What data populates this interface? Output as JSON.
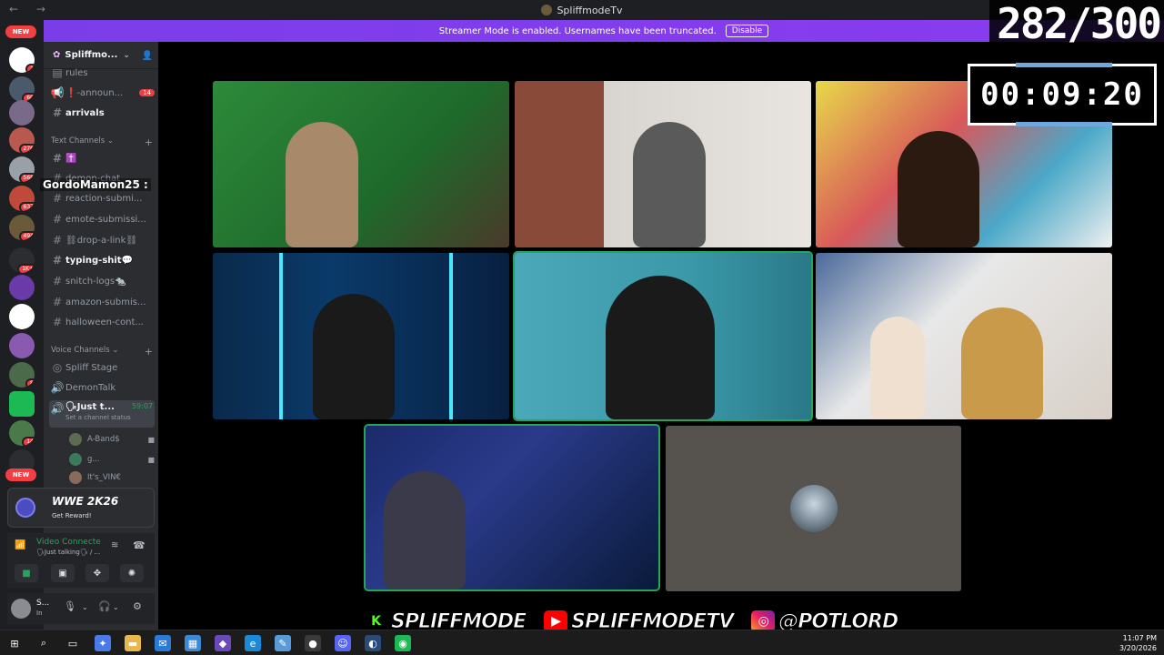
{
  "window": {
    "title": "SpliffmodeTv"
  },
  "banner": {
    "text": "Streamer Mode is enabled. Usernames have been truncated.",
    "button": "Disable"
  },
  "rail": {
    "new_top": "NEW",
    "new_bottom": "NEW",
    "badges": [
      "1",
      "60",
      "276",
      "568",
      "637",
      "494",
      "1K+",
      "8",
      "14"
    ]
  },
  "server": {
    "name": "Spliffmo..."
  },
  "channels": {
    "top": [
      {
        "name": "rules",
        "badge": ""
      },
      {
        "name": "❗-announ...",
        "badge": "14"
      },
      {
        "name": "arrivals",
        "badge": ""
      }
    ],
    "text_category": "Text Channels",
    "text": [
      {
        "name": "✝️",
        "bright": true
      },
      {
        "name": "demon-chat",
        "bright": false
      },
      {
        "name": "reaction-submi...",
        "bright": false
      },
      {
        "name": "emote-submissi...",
        "bright": false
      },
      {
        "name": "⛓drop-a-link⛓",
        "bright": false
      },
      {
        "name": "typing-shit💬",
        "bright": true
      },
      {
        "name": "snitch-logs🐀",
        "bright": false
      },
      {
        "name": "amazon-submis...",
        "bright": false
      },
      {
        "name": "halloween-cont...",
        "bright": false
      }
    ],
    "voice_category": "Voice Channels",
    "voice": [
      {
        "name": "Spliff Stage"
      },
      {
        "name": "DemonTalk"
      }
    ],
    "active_voice": {
      "name": "🗣Just t...",
      "time": "59:07",
      "status_hint": "Set a channel status"
    },
    "members": [
      {
        "name": "A-Band$"
      },
      {
        "name": "g..."
      },
      {
        "name": "It's_VIN€"
      }
    ]
  },
  "overlay_name": "GordoMamon25 :",
  "game_card": {
    "title": "WWE 2K26",
    "sub": "Get Reward!"
  },
  "voice_panel": {
    "status": "Video Connecte",
    "sub": "🗣Just talking🗣 / ..."
  },
  "user_panel": {
    "name": "S...",
    "status": "In"
  },
  "overlays": {
    "counter": "282/300",
    "timer": "00:09:20"
  },
  "socials": [
    {
      "icon": "kick",
      "text": "SPLIFFMODE"
    },
    {
      "icon": "youtube",
      "text": "SPLIFFMODETV"
    },
    {
      "icon": "instagram",
      "text": "@POTLORD"
    }
  ],
  "taskbar": {
    "time": "11:07 PM",
    "date": "3/20/2026"
  },
  "colors": {
    "banner": "#8a3cf0",
    "speaking": "#23a55a",
    "rail": "#1e1f22",
    "channels": "#2b2d31"
  }
}
